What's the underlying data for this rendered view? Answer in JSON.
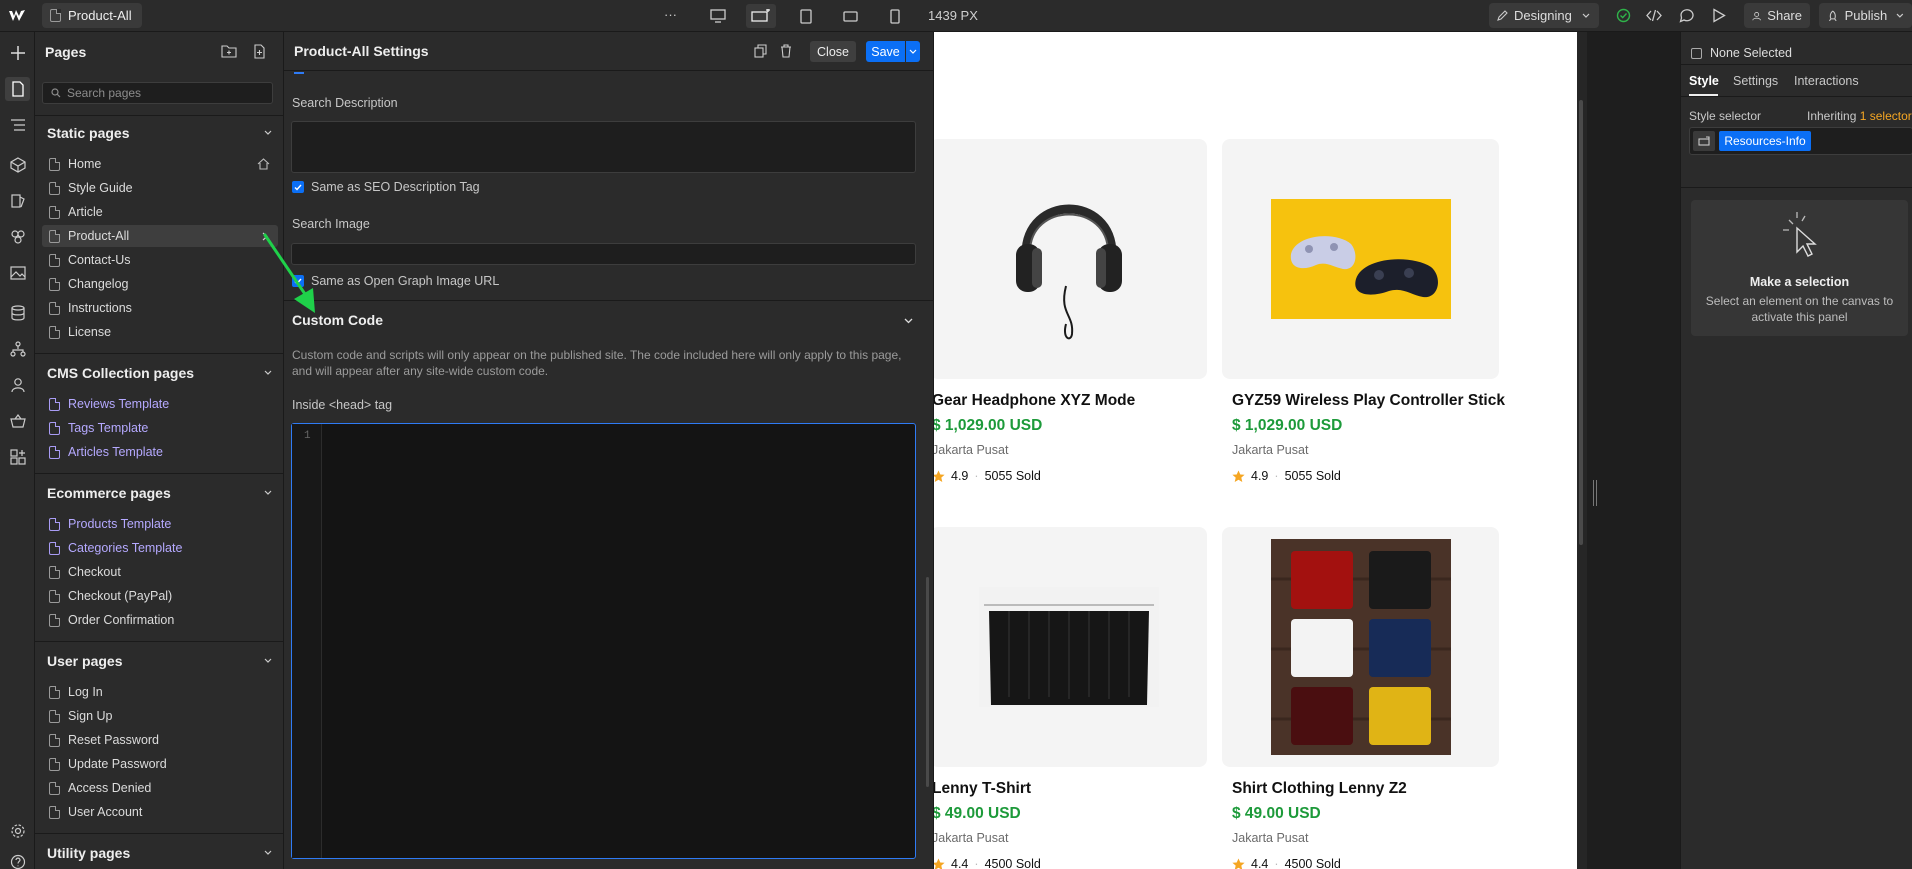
{
  "topbar": {
    "page_name": "Product-All",
    "more": "···",
    "canvas_width": "1439 PX",
    "mode": "Designing",
    "share": "Share",
    "publish": "Publish"
  },
  "pages_panel": {
    "title": "Pages",
    "search_placeholder": "Search pages",
    "sections": {
      "static": {
        "title": "Static pages",
        "items": [
          "Home",
          "Style Guide",
          "Article",
          "Product-All",
          "Contact-Us",
          "Changelog",
          "Instructions",
          "License"
        ],
        "selected": "Product-All"
      },
      "cms": {
        "title": "CMS Collection pages",
        "items": [
          "Reviews Template",
          "Tags Template",
          "Articles Template"
        ]
      },
      "ecommerce": {
        "title": "Ecommerce pages",
        "items": [
          "Products Template",
          "Categories Template",
          "Checkout",
          "Checkout (PayPal)",
          "Order Confirmation"
        ]
      },
      "user": {
        "title": "User pages",
        "items": [
          "Log In",
          "Sign Up",
          "Reset Password",
          "Update Password",
          "Access Denied",
          "User Account"
        ]
      },
      "utility": {
        "title": "Utility pages"
      }
    }
  },
  "settings_panel": {
    "title": "Product-All Settings",
    "close": "Close",
    "save": "Save",
    "search_description_label": "Search Description",
    "same_as_seo": "Same as SEO Description Tag",
    "search_image_label": "Search Image",
    "same_as_og": "Same as Open Graph Image URL",
    "custom_code_title": "Custom Code",
    "custom_code_note": "Custom code and scripts will only appear on the published site. The code included here will only apply to this page, and will appear after any site-wide custom code.",
    "inside_head_label": "Inside <head> tag",
    "code_line_number": "1"
  },
  "canvas": {
    "products": [
      {
        "name": "Gear Headphone XYZ Mode",
        "price": "$ 1,029.00 USD",
        "location": "Jakarta Pusat",
        "rating": "4.9",
        "sold": "5055 Sold"
      },
      {
        "name": "GYZ59 Wireless Play Controller Stick",
        "price": "$ 1,029.00 USD",
        "location": "Jakarta Pusat",
        "rating": "4.9",
        "sold": "5055 Sold"
      },
      {
        "name": "Lenny T-Shirt",
        "price": "$ 49.00 USD",
        "location": "Jakarta Pusat",
        "rating": "4.4",
        "sold": "4500 Sold"
      },
      {
        "name": "Shirt Clothing Lenny Z2",
        "price": "$ 49.00 USD",
        "location": "Jakarta Pusat",
        "rating": "4.4",
        "sold": "4500 Sold"
      }
    ]
  },
  "right_panel": {
    "none_selected": "None Selected",
    "tabs": [
      "Style",
      "Settings",
      "Interactions"
    ],
    "active_tab": "Style",
    "style_selector_label": "Style selector",
    "inheriting_prefix": "Inheriting",
    "inheriting_count": "1 selector",
    "selector_chip": "Resources-Info",
    "empty_title": "Make a selection",
    "empty_text": "Select an element on the canvas to activate this panel"
  },
  "colors": {
    "accent": "#0b6ff5",
    "price": "#1d9a3a",
    "annotation_arrow": "#1fd14a",
    "template_link": "#b5a9ff",
    "inheriting": "#f5a623"
  }
}
